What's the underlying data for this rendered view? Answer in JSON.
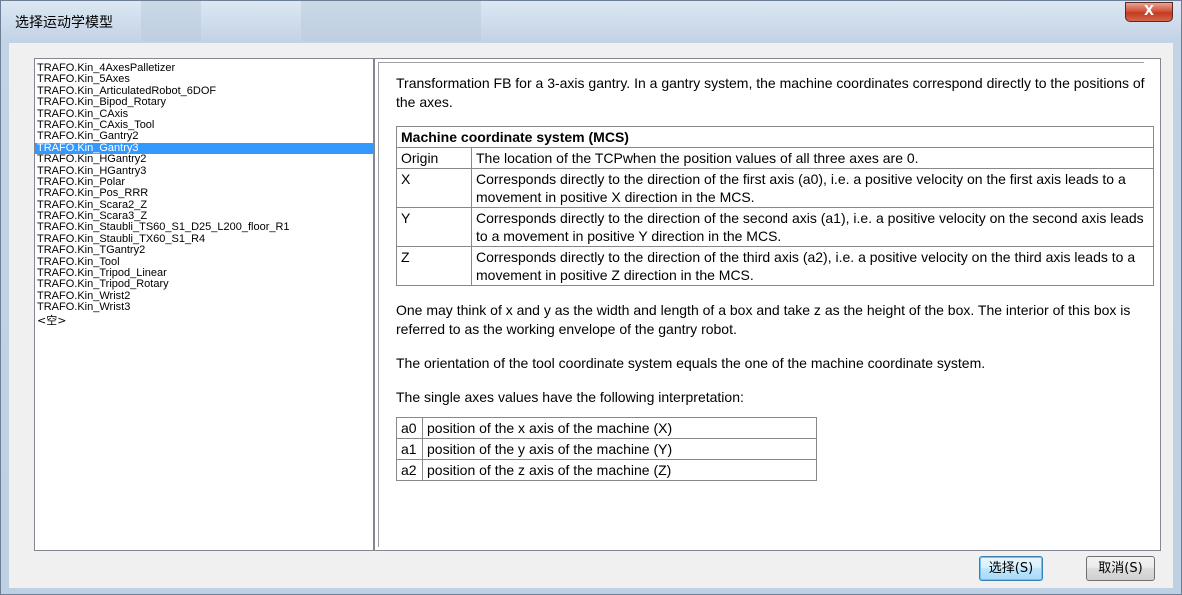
{
  "window": {
    "title": "选择运动学模型",
    "close_icon": "close-icon"
  },
  "kinematics_list": {
    "items": [
      "TRAFO.Kin_4AxesPalletizer",
      "TRAFO.Kin_5Axes",
      "TRAFO.Kin_ArticulatedRobot_6DOF",
      "TRAFO.Kin_Bipod_Rotary",
      "TRAFO.Kin_CAxis",
      "TRAFO.Kin_CAxis_Tool",
      "TRAFO.Kin_Gantry2",
      "TRAFO.Kin_Gantry3",
      "TRAFO.Kin_HGantry2",
      "TRAFO.Kin_HGantry3",
      "TRAFO.Kin_Polar",
      "TRAFO.Kin_Pos_RRR",
      "TRAFO.Kin_Scara2_Z",
      "TRAFO.Kin_Scara3_Z",
      "TRAFO.Kin_Staubli_TS60_S1_D25_L200_floor_R1",
      "TRAFO.Kin_Staubli_TX60_S1_R4",
      "TRAFO.Kin_TGantry2",
      "TRAFO.Kin_Tool",
      "TRAFO.Kin_Tripod_Linear",
      "TRAFO.Kin_Tripod_Rotary",
      "TRAFO.Kin_Wrist2",
      "TRAFO.Kin_Wrist3"
    ],
    "empty_item": "<空>",
    "selected_item": "TRAFO.Kin_Gantry3",
    "selection_color": "#3399ff"
  },
  "description": {
    "intro": "Transformation FB for a 3-axis gantry. In a gantry system, the machine coordinates correspond directly to the positions of the axes.",
    "mcs_table": {
      "header": "Machine coordinate system (MCS)",
      "rows": [
        {
          "key": "Origin",
          "value": "The location of the TCPwhen the position values of all three axes are 0."
        },
        {
          "key": "X",
          "value": "Corresponds directly to the direction of the first axis (a0), i.e. a positive velocity on the first axis leads to a movement in positive X direction in the MCS."
        },
        {
          "key": "Y",
          "value": "Corresponds directly to the direction of the second axis (a1), i.e. a positive velocity on the second axis leads to a movement in positive Y direction in the MCS."
        },
        {
          "key": "Z",
          "value": "Corresponds directly to the direction of the third axis (a2), i.e. a positive velocity on the third axis leads to a movement in positive Z direction in the MCS."
        }
      ]
    },
    "para1": "One may think of x and y as the width and length of a box and take z as the height of the box. The interior of this box is referred to as the working envelope of the gantry robot.",
    "para2": "The orientation of the tool coordinate system equals the one of the machine coordinate system.",
    "para3": "The single axes values have the following interpretation:",
    "axes_table": [
      {
        "key": "a0",
        "value": "position of the x axis of the machine (X)"
      },
      {
        "key": "a1",
        "value": "position of the y axis of the machine (Y)"
      },
      {
        "key": "a2",
        "value": "position of the z axis of the machine (Z)"
      }
    ]
  },
  "buttons": {
    "select_label": "选择(S)",
    "cancel_label": "取消(S)"
  }
}
